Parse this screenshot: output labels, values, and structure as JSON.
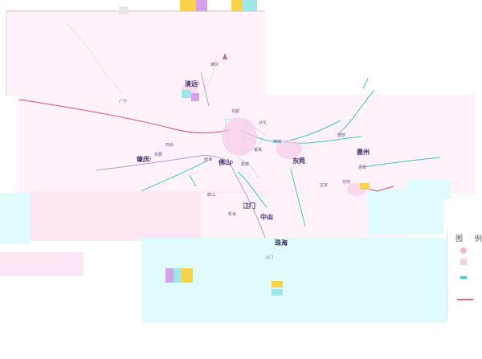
{
  "map": {
    "title": "",
    "colors": {
      "land": "#fff2fa",
      "land_alt": "#fde6f3",
      "sea": "#dffcfb",
      "road": "#3fc7c4",
      "road_light": "#8fe3df",
      "rail": "#d86a86",
      "river": "#b59ad9",
      "boundary": "#c9c9c9",
      "label": "#4a3d6b"
    },
    "cities": [
      {
        "key": "qingyuan",
        "name": "清远"
      },
      {
        "key": "zhaoqing",
        "name": "肇庆"
      },
      {
        "key": "foshan",
        "name": "佛山"
      },
      {
        "key": "dongguan",
        "name": "东莞"
      },
      {
        "key": "huizhou",
        "name": "惠州"
      },
      {
        "key": "jiangmen",
        "name": "江门"
      },
      {
        "key": "zhongshan",
        "name": "中山"
      },
      {
        "key": "zhuhai",
        "name": "珠海"
      }
    ],
    "towns": [
      {
        "key": "t1",
        "name": "广宁"
      },
      {
        "key": "t2",
        "name": "四会"
      },
      {
        "key": "t3",
        "name": "高要"
      },
      {
        "key": "t4",
        "name": "南海"
      },
      {
        "key": "t5",
        "name": "顺德"
      },
      {
        "key": "t6",
        "name": "番禺"
      },
      {
        "key": "t7",
        "name": "增城"
      },
      {
        "key": "t8",
        "name": "从化"
      },
      {
        "key": "t9",
        "name": "花都"
      },
      {
        "key": "t10",
        "name": "博罗"
      },
      {
        "key": "t11",
        "name": "惠阳"
      },
      {
        "key": "t12",
        "name": "鹤山"
      },
      {
        "key": "t13",
        "name": "新会"
      },
      {
        "key": "t14",
        "name": "斗门"
      },
      {
        "key": "t15",
        "name": "宝安"
      },
      {
        "key": "t16",
        "name": "龙岗"
      },
      {
        "key": "t17",
        "name": "佛冈"
      }
    ],
    "legend": {
      "title": "图 例"
    }
  }
}
